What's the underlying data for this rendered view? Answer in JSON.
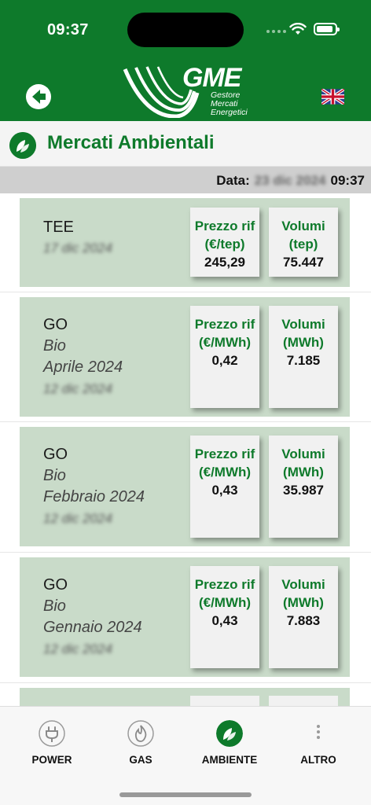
{
  "status_bar": {
    "time": "09:37"
  },
  "header": {
    "logo_text": "GME",
    "logo_sub": [
      "Gestore",
      "Mercati",
      "Energetici"
    ]
  },
  "section": {
    "title": "Mercati Ambientali"
  },
  "date_bar": {
    "label": "Data:",
    "date_blurred": "23 dic 2024",
    "time": "09:37"
  },
  "cards": [
    {
      "title": "TEE",
      "subtitle": "",
      "period": "",
      "date_blurred": "17 dic 2024",
      "price_header": [
        "Prezzo rif",
        "(€/tep)"
      ],
      "price_value": "245,29",
      "vol_header": [
        "Volumi",
        "(tep)"
      ],
      "vol_value": "75.447"
    },
    {
      "title": "GO",
      "subtitle": "Bio",
      "period": "Aprile 2024",
      "date_blurred": "12 dic 2024",
      "price_header": [
        "Prezzo rif",
        "(€/MWh)"
      ],
      "price_value": "0,42",
      "vol_header": [
        "Volumi",
        "(MWh)"
      ],
      "vol_value": "7.185"
    },
    {
      "title": "GO",
      "subtitle": "Bio",
      "period": "Febbraio 2024",
      "date_blurred": "12 dic 2024",
      "price_header": [
        "Prezzo rif",
        "(€/MWh)"
      ],
      "price_value": "0,43",
      "vol_header": [
        "Volumi",
        "(MWh)"
      ],
      "vol_value": "35.987"
    },
    {
      "title": "GO",
      "subtitle": "Bio",
      "period": "Gennaio 2024",
      "date_blurred": "12 dic 2024",
      "price_header": [
        "Prezzo rif",
        "(€/MWh)"
      ],
      "price_value": "0,43",
      "vol_header": [
        "Volumi",
        "(MWh)"
      ],
      "vol_value": "7.883"
    }
  ],
  "tabbar": [
    {
      "label": "POWER",
      "icon": "plug-icon",
      "active": false
    },
    {
      "label": "GAS",
      "icon": "flame-icon",
      "active": false
    },
    {
      "label": "AMBIENTE",
      "icon": "leaf-icon",
      "active": true
    },
    {
      "label": "ALTRO",
      "icon": "more-vertical-icon",
      "active": false
    }
  ],
  "colors": {
    "brand_green": "#0e7a2b",
    "card_bg": "#c9dbc9"
  }
}
